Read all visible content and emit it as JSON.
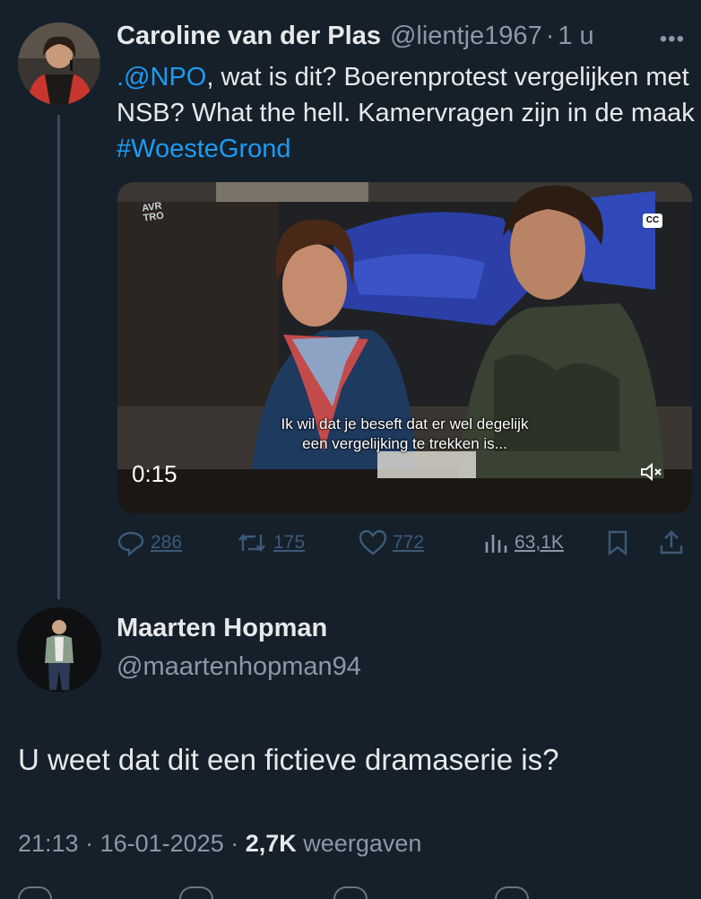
{
  "tweet1": {
    "name": "Caroline van der Plas",
    "handle": "@lientje1967",
    "time": "1 u",
    "more_icon": "more-horizontal-icon",
    "text_mention": ".@NPO",
    "text_body": ", wat is dit? Boerenprotest vergelijken met NSB? What the hell. Kamervragen zijn in de maak ",
    "hashtag": "#WoesteGrond",
    "media": {
      "logo_line1": "AVR",
      "logo_line2": "TRO",
      "cc_label": "CC",
      "subtitle_line1": "Ik wil dat je beseft dat er wel degelijk",
      "subtitle_line2": "een vergelijking te trekken is...",
      "duration": "0:15",
      "mute_icon": "muted-speaker-icon"
    },
    "actions": {
      "replies": "286",
      "reposts": "175",
      "likes": "772",
      "views": "63,1K"
    }
  },
  "tweet2": {
    "name": "Maarten Hopman",
    "handle": "@maartenhopman94",
    "text": "U weet dat dit een fictieve dramaserie is?",
    "time": "21:13",
    "date": "16-01-2025",
    "views_count": "2,7K",
    "views_label": "weergaven"
  },
  "colors": {
    "background": "#15202b",
    "link": "#1d9bf0",
    "secondary_text": "#8b98a5",
    "primary_text": "#e7e9ea"
  }
}
